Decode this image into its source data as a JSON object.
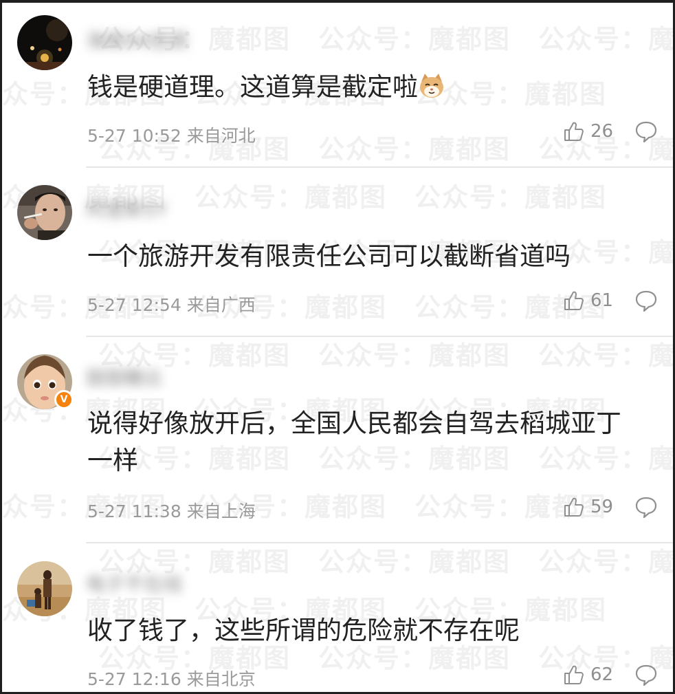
{
  "watermark": {
    "text": "公众号：魔都图",
    "color": "#000000"
  },
  "comments": [
    {
      "username": "海南94低调",
      "avatar_icon": "night-scene-avatar",
      "content": "钱是硬道理。这道算是截定啦",
      "emoji_icon": "cat-face-emoji",
      "timestamp": "5-27 10:52",
      "location": "来自河北",
      "likes": "26",
      "verified": false
    },
    {
      "username": "阿里斯SY",
      "avatar_icon": "man-smoking-avatar",
      "content": "一个旅游开发有限责任公司可以截断省道吗",
      "timestamp": "5-27 12:54",
      "location": "来自广西",
      "likes": "61",
      "verified": false
    },
    {
      "username": "甜甜糖云",
      "avatar_icon": "baby-avatar",
      "content": "说得好像放开后，全国人民都会自驾去稻城亚丁一样",
      "timestamp": "5-27 11:38",
      "location": "来自上海",
      "likes": "59",
      "verified": true,
      "verified_badge": "V"
    },
    {
      "username": "电子不在线",
      "avatar_icon": "desert-children-avatar",
      "content": "收了钱了，这些所谓的危险就不存在呢",
      "timestamp": "5-27 12:16",
      "location": "来自北京",
      "likes": "62",
      "verified": false
    }
  ],
  "icons": {
    "like": "thumbs-up-icon",
    "reply": "comment-bubble-icon"
  },
  "colors": {
    "text": "#222222",
    "meta": "#9a9a9a",
    "divider": "#e6e6e6",
    "verified_badge": "#f5820d"
  }
}
